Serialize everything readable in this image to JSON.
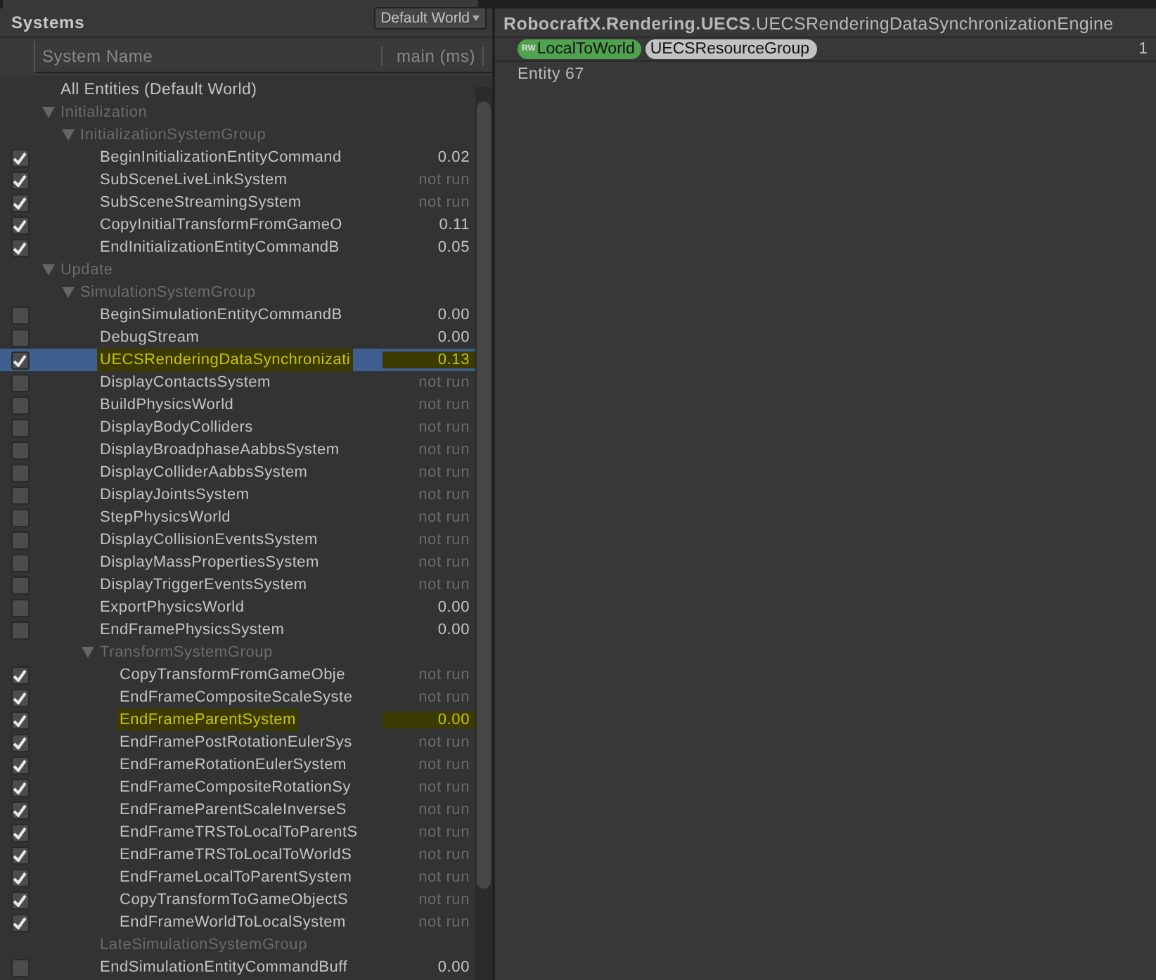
{
  "panel": {
    "title": "Systems",
    "world_dropdown": "Default World",
    "columns": [
      "System Name",
      "main (ms)"
    ]
  },
  "tree": [
    {
      "kind": "root",
      "name": "All Entities (Default World)"
    },
    {
      "kind": "group",
      "name": "Initialization",
      "expanded": true,
      "children": [
        {
          "kind": "group",
          "name": "InitializationSystemGroup",
          "expanded": true,
          "children": [
            {
              "kind": "system",
              "name": "BeginInitializationEntityCommand",
              "checked": true,
              "time": "0.02",
              "ran": true,
              "selected": false,
              "highlighted": false
            },
            {
              "kind": "system",
              "name": "SubSceneLiveLinkSystem",
              "checked": true,
              "time": "not run",
              "ran": false,
              "selected": false,
              "highlighted": false
            },
            {
              "kind": "system",
              "name": "SubSceneStreamingSystem",
              "checked": true,
              "time": "not run",
              "ran": false,
              "selected": false,
              "highlighted": false
            },
            {
              "kind": "system",
              "name": "CopyInitialTransformFromGameO",
              "checked": true,
              "time": "0.11",
              "ran": true,
              "selected": false,
              "highlighted": false
            },
            {
              "kind": "system",
              "name": "EndInitializationEntityCommandB",
              "checked": true,
              "time": "0.05",
              "ran": true,
              "selected": false,
              "highlighted": false
            }
          ]
        }
      ]
    },
    {
      "kind": "group",
      "name": "Update",
      "expanded": true,
      "children": [
        {
          "kind": "group",
          "name": "SimulationSystemGroup",
          "expanded": true,
          "children": [
            {
              "kind": "system",
              "name": "BeginSimulationEntityCommandB",
              "checked": false,
              "time": "0.00",
              "ran": true,
              "selected": false,
              "highlighted": false
            },
            {
              "kind": "system",
              "name": "DebugStream",
              "checked": false,
              "time": "0.00",
              "ran": true,
              "selected": false,
              "highlighted": false
            },
            {
              "kind": "system",
              "name": "UECSRenderingDataSynchronizati",
              "checked": true,
              "time": "0.13",
              "ran": true,
              "selected": true,
              "highlighted": true
            },
            {
              "kind": "system",
              "name": "DisplayContactsSystem",
              "checked": false,
              "time": "not run",
              "ran": false,
              "selected": false,
              "highlighted": false
            },
            {
              "kind": "system",
              "name": "BuildPhysicsWorld",
              "checked": false,
              "time": "not run",
              "ran": false,
              "selected": false,
              "highlighted": false
            },
            {
              "kind": "system",
              "name": "DisplayBodyColliders",
              "checked": false,
              "time": "not run",
              "ran": false,
              "selected": false,
              "highlighted": false
            },
            {
              "kind": "system",
              "name": "DisplayBroadphaseAabbsSystem",
              "checked": false,
              "time": "not run",
              "ran": false,
              "selected": false,
              "highlighted": false
            },
            {
              "kind": "system",
              "name": "DisplayColliderAabbsSystem",
              "checked": false,
              "time": "not run",
              "ran": false,
              "selected": false,
              "highlighted": false
            },
            {
              "kind": "system",
              "name": "DisplayJointsSystem",
              "checked": false,
              "time": "not run",
              "ran": false,
              "selected": false,
              "highlighted": false
            },
            {
              "kind": "system",
              "name": "StepPhysicsWorld",
              "checked": false,
              "time": "not run",
              "ran": false,
              "selected": false,
              "highlighted": false
            },
            {
              "kind": "system",
              "name": "DisplayCollisionEventsSystem",
              "checked": false,
              "time": "not run",
              "ran": false,
              "selected": false,
              "highlighted": false
            },
            {
              "kind": "system",
              "name": "DisplayMassPropertiesSystem",
              "checked": false,
              "time": "not run",
              "ran": false,
              "selected": false,
              "highlighted": false
            },
            {
              "kind": "system",
              "name": "DisplayTriggerEventsSystem",
              "checked": false,
              "time": "not run",
              "ran": false,
              "selected": false,
              "highlighted": false
            },
            {
              "kind": "system",
              "name": "ExportPhysicsWorld",
              "checked": false,
              "time": "0.00",
              "ran": true,
              "selected": false,
              "highlighted": false
            },
            {
              "kind": "system",
              "name": "EndFramePhysicsSystem",
              "checked": false,
              "time": "0.00",
              "ran": true,
              "selected": false,
              "highlighted": false
            },
            {
              "kind": "group",
              "name": "TransformSystemGroup",
              "expanded": true,
              "children": [
                {
                  "kind": "system",
                  "name": "CopyTransformFromGameObje",
                  "checked": true,
                  "time": "not run",
                  "ran": false,
                  "selected": false,
                  "highlighted": false
                },
                {
                  "kind": "system",
                  "name": "EndFrameCompositeScaleSyste",
                  "checked": true,
                  "time": "not run",
                  "ran": false,
                  "selected": false,
                  "highlighted": false
                },
                {
                  "kind": "system",
                  "name": "EndFrameParentSystem",
                  "checked": true,
                  "time": "0.00",
                  "ran": true,
                  "selected": false,
                  "highlighted": true
                },
                {
                  "kind": "system",
                  "name": "EndFramePostRotationEulerSys",
                  "checked": true,
                  "time": "not run",
                  "ran": false,
                  "selected": false,
                  "highlighted": false
                },
                {
                  "kind": "system",
                  "name": "EndFrameRotationEulerSystem",
                  "checked": true,
                  "time": "not run",
                  "ran": false,
                  "selected": false,
                  "highlighted": false
                },
                {
                  "kind": "system",
                  "name": "EndFrameCompositeRotationSy",
                  "checked": true,
                  "time": "not run",
                  "ran": false,
                  "selected": false,
                  "highlighted": false
                },
                {
                  "kind": "system",
                  "name": "EndFrameParentScaleInverseS",
                  "checked": true,
                  "time": "not run",
                  "ran": false,
                  "selected": false,
                  "highlighted": false
                },
                {
                  "kind": "system",
                  "name": "EndFrameTRSToLocalToParentS",
                  "checked": true,
                  "time": "not run",
                  "ran": false,
                  "selected": false,
                  "highlighted": false
                },
                {
                  "kind": "system",
                  "name": "EndFrameTRSToLocalToWorldS",
                  "checked": true,
                  "time": "not run",
                  "ran": false,
                  "selected": false,
                  "highlighted": false
                },
                {
                  "kind": "system",
                  "name": "EndFrameLocalToParentSystem",
                  "checked": true,
                  "time": "not run",
                  "ran": false,
                  "selected": false,
                  "highlighted": false
                },
                {
                  "kind": "system",
                  "name": "CopyTransformToGameObjectS",
                  "checked": true,
                  "time": "not run",
                  "ran": false,
                  "selected": false,
                  "highlighted": false
                },
                {
                  "kind": "system",
                  "name": "EndFrameWorldToLocalSystem",
                  "checked": true,
                  "time": "not run",
                  "ran": false,
                  "selected": false,
                  "highlighted": false
                }
              ]
            },
            {
              "kind": "group",
              "name": "LateSimulationSystemGroup"
            },
            {
              "kind": "system",
              "name": "EndSimulationEntityCommandBuff",
              "checked": false,
              "time": "0.00",
              "ran": true,
              "selected": false,
              "highlighted": false
            }
          ]
        }
      ]
    }
  ],
  "detail": {
    "title": "**RobocraftX.Rendering.UECS**.UECSRenderingDataSynchronizationEngine",
    "query": {
      "components": [
        {
          "name": "LocalToWorld",
          "access": "RW",
          "color": "#4fa34f"
        },
        {
          "name": "UECSResourceGroup",
          "color": "#c2c2c2"
        }
      ],
      "count": "1"
    },
    "entities": [
      "Entity 67"
    ]
  }
}
